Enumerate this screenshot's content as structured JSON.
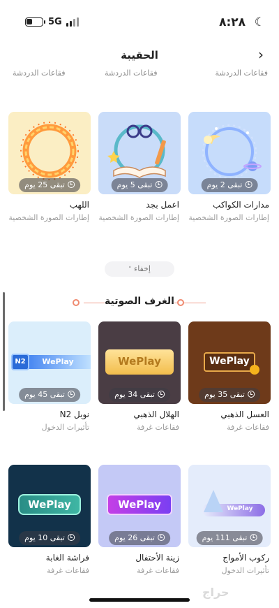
{
  "status_bar": {
    "time": "٨:٢٨",
    "network": "5G"
  },
  "header": {
    "title": "الحقيبة",
    "subtabs": [
      "فقاعات الدردشة",
      "فقاعات الدردشة",
      "فقاعات الدردشة"
    ]
  },
  "frames": [
    {
      "name": "مدارات الكواكب",
      "category": "إطارات الصورة الشخصية",
      "days_left": "تبقى 2 يوم"
    },
    {
      "name": "اعمل بجد",
      "category": "إطارات الصورة الشخصية",
      "days_left": "تبقى 5 يوم"
    },
    {
      "name": "اللهب",
      "category": "إطارات الصورة الشخصية",
      "days_left": "تبقى 25 يوم"
    }
  ],
  "collapse_label": "إخفاء",
  "voice_rooms": {
    "title": "الغرف الصوتية",
    "items": [
      {
        "name": "العسل الذهبي",
        "category": "فقاعات غرفة",
        "days_left": "تبقى 35 يوم",
        "brand": "WePlay"
      },
      {
        "name": "الهلال الذهبي",
        "category": "فقاعات غرفة",
        "days_left": "تبقى 34 يوم",
        "brand": "WePlay"
      },
      {
        "name": "نوبل N2",
        "category": "تأثيرات الدخول",
        "days_left": "تبقى 45 يوم",
        "brand": "WePlay",
        "tag": "N2"
      },
      {
        "name": "ركوب الأمواج",
        "category": "تأثيرات الدخول",
        "days_left": "تبقى 111 يوم",
        "brand": "WePlay"
      },
      {
        "name": "زينة الأحتفال",
        "category": "فقاعات غرفة",
        "days_left": "تبقى 26 يوم",
        "brand": "WePlay"
      },
      {
        "name": "فراشة الغابة",
        "category": "فقاعات غرفة",
        "days_left": "تبقى 10 يوم",
        "brand": "WePlay"
      }
    ]
  },
  "watermark": "حراج",
  "colors": {
    "accent": "#ef8a70",
    "badge_bg": "#3c3c46",
    "muted_text": "#9a9a9a"
  },
  "icons": [
    "moon-icon",
    "battery-icon",
    "signal-icon",
    "back-chevron-icon",
    "clock-icon",
    "chevron-up-icon"
  ]
}
